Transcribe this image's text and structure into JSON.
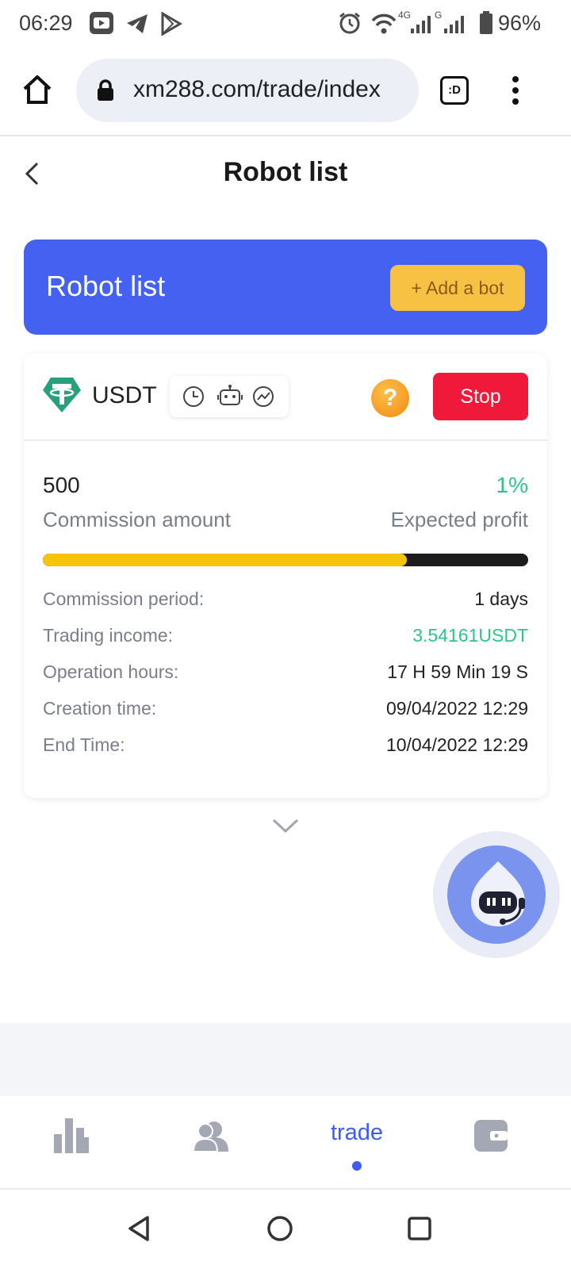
{
  "status_bar": {
    "time": "06:29",
    "battery": "96%",
    "network_badge_1": "4G",
    "network_badge_2": "G"
  },
  "browser": {
    "url": "xm288.com/trade/index",
    "tab_badge": ":D"
  },
  "header": {
    "title": "Robot list"
  },
  "banner": {
    "title": "Robot list",
    "add_button": "+ Add a bot"
  },
  "robot": {
    "coin": "USDT",
    "help": "?",
    "stop_button": "Stop",
    "commission_amount": "500",
    "commission_amount_label": "Commission amount",
    "expected_profit": "1%",
    "expected_profit_label": "Expected profit",
    "progress_fraction": 0.75,
    "details": [
      {
        "label": "Commission period:",
        "value": "1 days"
      },
      {
        "label": "Trading income:",
        "value": "3.54161USDT"
      },
      {
        "label": "Operation hours:",
        "value": "17 H 59 Min 19 S"
      },
      {
        "label": "Creation time:",
        "value": "09/04/2022 12:29"
      },
      {
        "label": "End Time:",
        "value": "10/04/2022 12:29"
      }
    ]
  },
  "tabs": [
    {
      "name": "markets",
      "label": "",
      "icon": "bar-chart-icon"
    },
    {
      "name": "team",
      "label": "",
      "icon": "users-icon"
    },
    {
      "name": "trade",
      "label": "trade",
      "icon": "",
      "active": true
    },
    {
      "name": "wallet",
      "label": "",
      "icon": "wallet-icon"
    }
  ],
  "colors": {
    "accent": "#4461f2",
    "add_button": "#f7c243",
    "stop": "#f0193a",
    "profit_green": "#2ec48a",
    "progress": "#f6c40a"
  }
}
